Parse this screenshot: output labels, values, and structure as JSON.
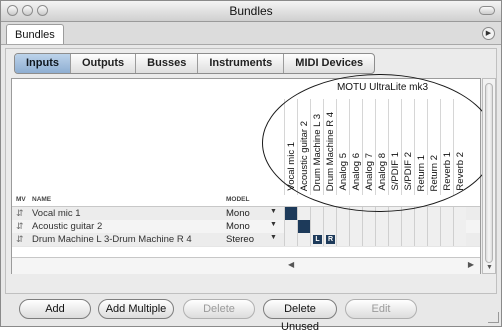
{
  "window": {
    "title": "Bundles"
  },
  "doc_tab": {
    "label": "Bundles"
  },
  "segments": [
    {
      "label": "Inputs",
      "active": true
    },
    {
      "label": "Outputs",
      "active": false
    },
    {
      "label": "Busses",
      "active": false
    },
    {
      "label": "Instruments",
      "active": false
    },
    {
      "label": "MIDI Devices",
      "active": false
    }
  ],
  "device": {
    "name": "MOTU UltraLite mk3"
  },
  "channels": [
    "Vocal mic 1",
    "Acoustic guitar 2",
    "Drum Machine L 3",
    "Drum Machine R 4",
    "Analog 5",
    "Analog 6",
    "Analog 7",
    "Analog 8",
    "S/PDIF 1",
    "S/PDIF 2",
    "Return 1",
    "Return 2",
    "Reverb 1",
    "Reverb 2"
  ],
  "columns": {
    "mv": "MV",
    "name": "NAME",
    "model": "MODEL"
  },
  "rows": [
    {
      "name": "Vocal mic 1",
      "model": "Mono",
      "active_cells": [
        0
      ],
      "labels": {}
    },
    {
      "name": "Acoustic guitar 2",
      "model": "Mono",
      "active_cells": [
        1
      ],
      "labels": {}
    },
    {
      "name": "Drum Machine L 3-Drum Machine R 4",
      "model": "Stereo",
      "active_cells": [],
      "labels": {
        "2": "L",
        "3": "R"
      }
    }
  ],
  "buttons": [
    {
      "label": "Add",
      "enabled": true
    },
    {
      "label": "Add Multiple",
      "enabled": true
    },
    {
      "label": "Delete",
      "enabled": false
    },
    {
      "label": "Delete Unused",
      "enabled": true
    },
    {
      "label": "Edit",
      "enabled": false
    }
  ],
  "colors": {
    "selected_segment": "#8eaed2",
    "connection": "#1d3a5a"
  }
}
